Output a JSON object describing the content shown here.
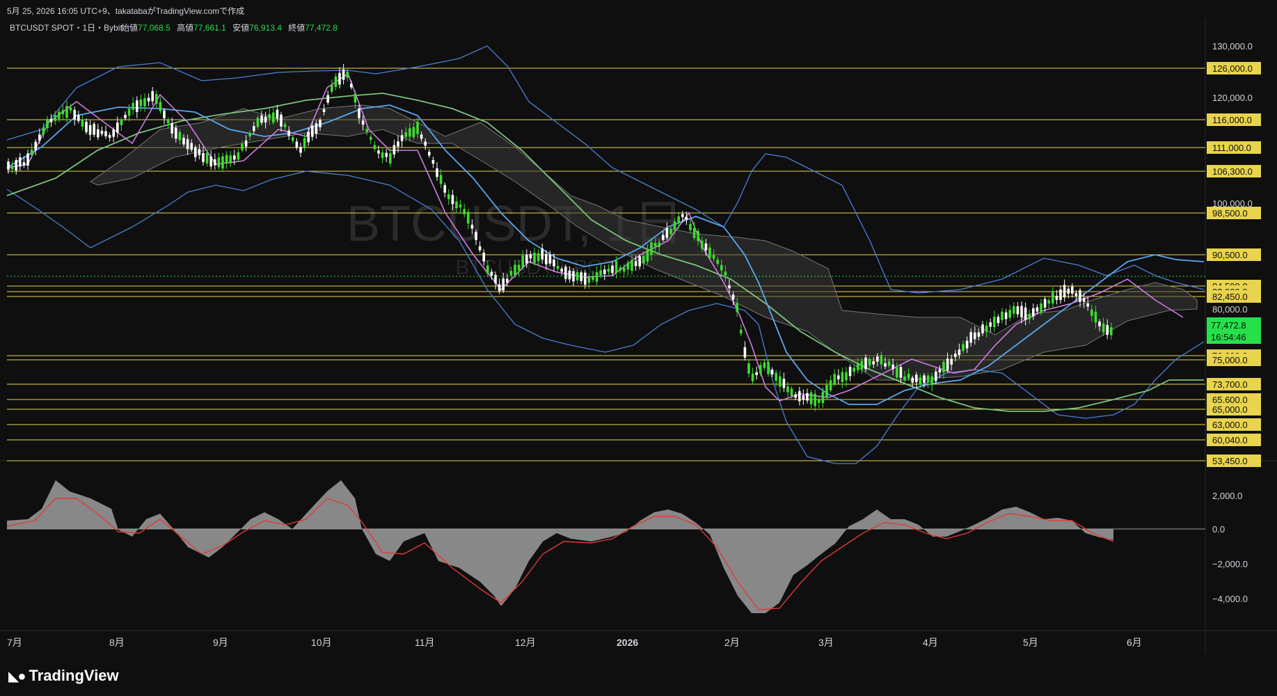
{
  "header": {
    "caption": "5月 25, 2026 16:05 UTC+9、takatabaがTradingView.comで作成"
  },
  "legend": {
    "symbol": "BTCUSDT SPOT・1日・Bybit",
    "open_label": "始値",
    "open": "77,068.5",
    "high_label": "高値",
    "high": "77,661.1",
    "low_label": "安値",
    "low": "76,913.4",
    "close_label": "終値",
    "close": "77,472.8"
  },
  "watermark": {
    "main": "BTCUSDT, 1日",
    "sub": "BTCUSDT SPOT"
  },
  "price_axis": {
    "ticks": [
      "130,000.0",
      "120,000.0",
      "100,000.0",
      "80,000.0"
    ],
    "level_labels": [
      "126,000.0",
      "116,000.0",
      "111,000.0",
      "106,300.0",
      "98,500.0",
      "90,500.0",
      "84,500.0",
      "82,900.0",
      "82,450.0",
      "76,000.0",
      "75,000.0",
      "73,700.0",
      "65,600.0",
      "65,000.0",
      "63,000.0",
      "60,040.0",
      "53,450.0"
    ],
    "last_price": "77,472.8",
    "countdown": "16:54:46"
  },
  "macd_axis": {
    "ticks": [
      "2,000.0",
      "0.0",
      "−2,000.0",
      "−4,000.0"
    ]
  },
  "time_axis": {
    "labels": [
      "7月",
      "8月",
      "9月",
      "10月",
      "11月",
      "12月",
      "2026",
      "2月",
      "3月",
      "4月",
      "5月",
      "6月"
    ]
  },
  "colors": {
    "level_line": "#e8d44d",
    "last_price_bg": "#26e04a",
    "up_candle": "#3ddc2e",
    "down_candle": "#ffffff",
    "bb": "#4a7fd8",
    "sma_long": "#7bc47f",
    "ema_fast": "#d07ce0",
    "ema_mid": "#5aa8f0",
    "cloud": "#5a5a5a",
    "macd_hist": "#9e9e9e",
    "macd_signal": "#e03a3a"
  },
  "brand": {
    "name": "TradingView",
    "icon": "tradingview-logo-icon"
  }
}
